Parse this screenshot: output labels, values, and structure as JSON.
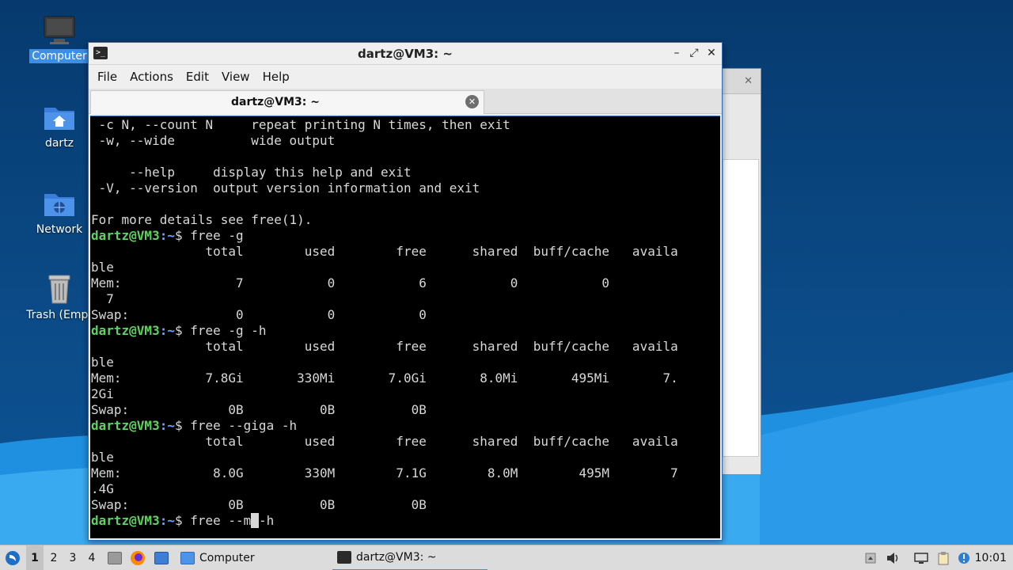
{
  "desktop": {
    "icons": [
      {
        "label": "Computer",
        "icon": "computer-icon",
        "selected": true
      },
      {
        "label": "dartz",
        "icon": "home-folder-icon"
      },
      {
        "label": "Network",
        "icon": "network-folder-icon"
      },
      {
        "label": "Trash (Empt",
        "icon": "trash-icon"
      }
    ]
  },
  "window": {
    "title": "dartz@VM3: ~",
    "controls": {
      "minimize": "–",
      "maximize": "⤢",
      "close": "✕"
    },
    "app_icon": ">_"
  },
  "menu": [
    "File",
    "Actions",
    "Edit",
    "View",
    "Help"
  ],
  "tab": {
    "label": "dartz@VM3: ~",
    "close": "✕"
  },
  "terminal": {
    "prompt_user": "dartz@VM3",
    "prompt_path": ":~",
    "prompt_end": "$ ",
    "lines": [
      {
        "text": " -c N, --count N     repeat printing N times, then exit"
      },
      {
        "text": " -w, --wide          wide output"
      },
      {
        "text": ""
      },
      {
        "text": "     --help     display this help and exit"
      },
      {
        "text": " -V, --version  output version information and exit"
      },
      {
        "text": ""
      },
      {
        "text": "For more details see free(1)."
      },
      {
        "prompt": true,
        "text": "free -g"
      },
      {
        "text": "               total        used        free      shared  buff/cache   availa"
      },
      {
        "text": "ble"
      },
      {
        "text": "Mem:               7           0           6           0           0"
      },
      {
        "text": "  7"
      },
      {
        "text": "Swap:              0           0           0"
      },
      {
        "prompt": true,
        "text": "free -g -h"
      },
      {
        "text": "               total        used        free      shared  buff/cache   availa"
      },
      {
        "text": "ble"
      },
      {
        "text": "Mem:           7.8Gi       330Mi       7.0Gi       8.0Mi       495Mi       7."
      },
      {
        "text": "2Gi"
      },
      {
        "text": "Swap:             0B          0B          0B"
      },
      {
        "prompt": true,
        "text": "free --giga -h"
      },
      {
        "text": "               total        used        free      shared  buff/cache   availa"
      },
      {
        "text": "ble"
      },
      {
        "text": "Mem:            8.0G        330M        7.1G        8.0M        495M        7"
      },
      {
        "text": ".4G"
      },
      {
        "text": "Swap:             0B          0B          0B"
      },
      {
        "prompt": true,
        "text": "free --m",
        "cursor": " ",
        "after": "-h"
      }
    ]
  },
  "taskbar": {
    "workspaces": [
      "1",
      "2",
      "3",
      "4"
    ],
    "active_workspace": "1",
    "tasks": [
      {
        "label": "Computer",
        "icon": "folder-icon"
      },
      {
        "label": "dartz@VM3: ~",
        "icon": "terminal-icon",
        "active": true
      }
    ],
    "clock": "10:01"
  },
  "colors": {
    "accent": "#3d8ee6",
    "prompt_user": "#5fd35f",
    "prompt_path": "#6aa8ff",
    "terminal_bg": "#000000",
    "terminal_fg": "#d8d8d8"
  }
}
